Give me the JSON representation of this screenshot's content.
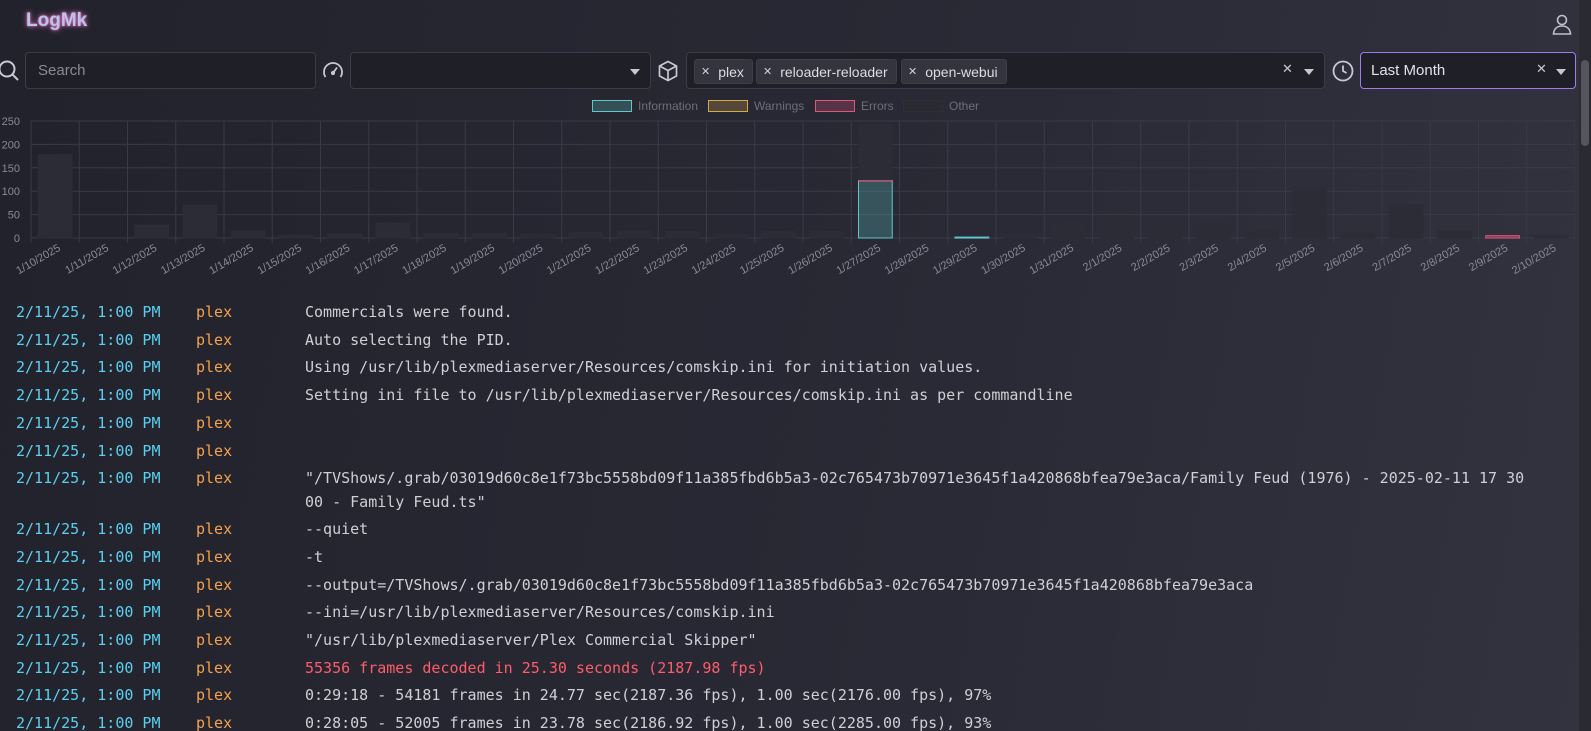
{
  "app": {
    "title": "LogMk"
  },
  "header": {
    "user_icon": "user-icon"
  },
  "filters": {
    "search_placeholder": "Search",
    "search_icon": "search-icon",
    "level_icon": "gauge-icon",
    "level_value": "",
    "source_icon": "cube-icon",
    "sources": [
      "plex",
      "reloader-reloader",
      "open-webui"
    ],
    "time_icon": "clock-icon",
    "time_range": "Last Month"
  },
  "colors": {
    "information": "#5fc7c7",
    "warnings": "#d4a94c",
    "errors": "#e0557a",
    "other": "#2e2e38",
    "timestamp": "#5ad0f0",
    "source": "#f4a24f",
    "error_text": "#ff5c6a"
  },
  "chart_data": {
    "type": "bar",
    "stacked": true,
    "legend": [
      "Information",
      "Warnings",
      "Errors",
      "Other"
    ],
    "legend_position": "top-center",
    "y_ticks": [
      "250",
      "200",
      "150",
      "100",
      "50",
      "0"
    ],
    "ylim": [
      0,
      250
    ],
    "grid": true,
    "categories": [
      "1/10/2025",
      "1/11/2025",
      "1/12/2025",
      "1/13/2025",
      "1/14/2025",
      "1/15/2025",
      "1/16/2025",
      "1/17/2025",
      "1/18/2025",
      "1/19/2025",
      "1/20/2025",
      "1/21/2025",
      "1/22/2025",
      "1/23/2025",
      "1/24/2025",
      "1/25/2025",
      "1/26/2025",
      "1/27/2025",
      "1/28/2025",
      "1/29/2025",
      "1/30/2025",
      "1/31/2025",
      "2/1/2025",
      "2/2/2025",
      "2/3/2025",
      "2/4/2025",
      "2/5/2025",
      "2/6/2025",
      "2/7/2025",
      "2/8/2025",
      "2/9/2025",
      "2/10/2025"
    ],
    "series": [
      {
        "name": "Information",
        "values": [
          0,
          0,
          0,
          0,
          0,
          0,
          0,
          0,
          0,
          0,
          0,
          0,
          0,
          0,
          0,
          0,
          0,
          122,
          0,
          2,
          0,
          0,
          0,
          0,
          0,
          0,
          0,
          0,
          0,
          0,
          0,
          0
        ]
      },
      {
        "name": "Warnings",
        "values": [
          0,
          0,
          0,
          0,
          0,
          0,
          0,
          0,
          0,
          0,
          0,
          0,
          0,
          0,
          0,
          0,
          0,
          0,
          0,
          0,
          0,
          0,
          0,
          0,
          0,
          0,
          0,
          0,
          0,
          0,
          0,
          0
        ]
      },
      {
        "name": "Errors",
        "values": [
          0,
          0,
          0,
          0,
          0,
          0,
          0,
          0,
          0,
          0,
          0,
          0,
          0,
          0,
          0,
          0,
          0,
          3,
          0,
          0,
          0,
          0,
          0,
          0,
          0,
          0,
          0,
          0,
          0,
          0,
          5,
          0
        ]
      },
      {
        "name": "Other",
        "values": [
          178,
          0,
          28,
          70,
          15,
          6,
          8,
          32,
          10,
          10,
          8,
          12,
          15,
          14,
          8,
          14,
          14,
          118,
          0,
          0,
          8,
          32,
          48,
          32,
          32,
          14,
          106,
          10,
          70,
          15,
          0,
          6
        ]
      }
    ]
  },
  "logs": [
    {
      "ts": "2/11/25, 1:00 PM",
      "source": "plex",
      "message": "Commercials were found."
    },
    {
      "ts": "2/11/25, 1:00 PM",
      "source": "plex",
      "message": "Auto selecting the PID."
    },
    {
      "ts": "2/11/25, 1:00 PM",
      "source": "plex",
      "message": "Using /usr/lib/plexmediaserver/Resources/comskip.ini for initiation values."
    },
    {
      "ts": "2/11/25, 1:00 PM",
      "source": "plex",
      "message": "Setting ini file to /usr/lib/plexmediaserver/Resources/comskip.ini as per commandline"
    },
    {
      "ts": "2/11/25, 1:00 PM",
      "source": "plex",
      "message": ""
    },
    {
      "ts": "2/11/25, 1:00 PM",
      "source": "plex",
      "message": ""
    },
    {
      "ts": "2/11/25, 1:00 PM",
      "source": "plex",
      "message": "\"/TVShows/.grab/03019d60c8e1f73bc5558bd09f11a385fbd6b5a3-02c765473b70971e3645f1a420868bfea79e3aca/Family Feud (1976) - 2025-02-11 17 30 00 - Family Feud.ts\""
    },
    {
      "ts": "2/11/25, 1:00 PM",
      "source": "plex",
      "message": "--quiet"
    },
    {
      "ts": "2/11/25, 1:00 PM",
      "source": "plex",
      "message": "-t"
    },
    {
      "ts": "2/11/25, 1:00 PM",
      "source": "plex",
      "message": "--output=/TVShows/.grab/03019d60c8e1f73bc5558bd09f11a385fbd6b5a3-02c765473b70971e3645f1a420868bfea79e3aca"
    },
    {
      "ts": "2/11/25, 1:00 PM",
      "source": "plex",
      "message": "--ini=/usr/lib/plexmediaserver/Resources/comskip.ini"
    },
    {
      "ts": "2/11/25, 1:00 PM",
      "source": "plex",
      "message": "\"/usr/lib/plexmediaserver/Plex Commercial Skipper\""
    },
    {
      "ts": "2/11/25, 1:00 PM",
      "source": "plex",
      "message": "55356 frames decoded in 25.30 seconds (2187.98 fps)",
      "level": "error"
    },
    {
      "ts": "2/11/25, 1:00 PM",
      "source": "plex",
      "message": "0:29:18 - 54181 frames in 24.77 sec(2187.36 fps), 1.00 sec(2176.00 fps), 97%"
    },
    {
      "ts": "2/11/25, 1:00 PM",
      "source": "plex",
      "message": "0:28:05 - 52005 frames in 23.78 sec(2186.92 fps), 1.00 sec(2285.00 fps), 93%"
    }
  ]
}
